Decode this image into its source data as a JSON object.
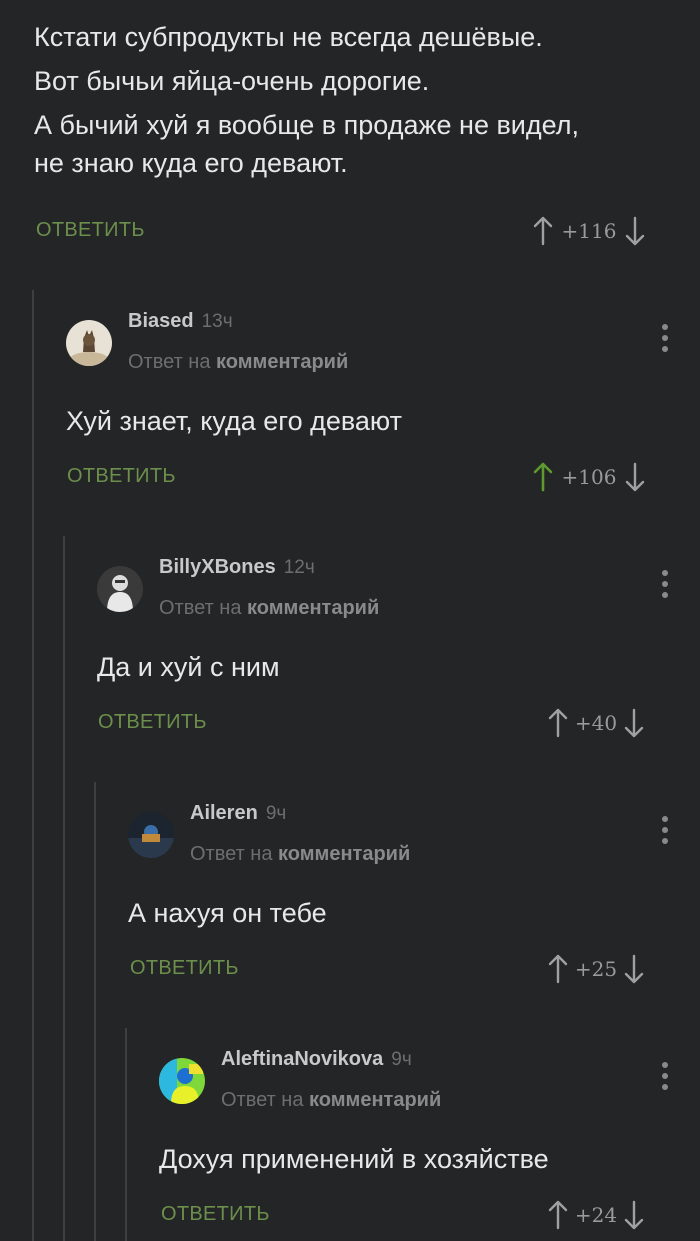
{
  "root_comment": {
    "lines": [
      "Кстати субпродукты не всегда дешёвые.",
      "Вот бычьи яйца-очень дорогие.",
      "А бычий хуй я вообще в продаже не видел,",
      "не знаю куда его девают."
    ],
    "reply_label": "ОТВЕТИТЬ",
    "score": "+116"
  },
  "comments": [
    {
      "author": "Biased",
      "time": "13ч",
      "reply_prefix": "Ответ на",
      "reply_target": "комментарий",
      "text": "Хуй знает, куда его девают",
      "reply_label": "ОТВЕТИТЬ",
      "score": "+106",
      "upvoted": true
    },
    {
      "author": "BillyXBones",
      "time": "12ч",
      "reply_prefix": "Ответ на",
      "reply_target": "комментарий",
      "text": "Да и хуй с ним",
      "reply_label": "ОТВЕТИТЬ",
      "score": "+40",
      "upvoted": false
    },
    {
      "author": "Aileren",
      "time": "9ч",
      "reply_prefix": "Ответ на",
      "reply_target": "комментарий",
      "text": "А нахуя он тебе",
      "reply_label": "ОТВЕТИТЬ",
      "score": "+25",
      "upvoted": false
    },
    {
      "author": "AleftinaNovikova",
      "time": "9ч",
      "reply_prefix": "Ответ на",
      "reply_target": "комментарий",
      "text": "Дохуя применений в хозяйстве",
      "reply_label": "ОТВЕТИТЬ",
      "score": "+24",
      "upvoted": false
    }
  ],
  "colors": {
    "background": "#232527",
    "accent_green": "#6c8f4b",
    "upvote_active": "#5e9a2e",
    "arrow_default": "#a0a0a0",
    "thread_line": "#3d3f41"
  },
  "icons": {
    "upvote": "arrow-up-icon",
    "downvote": "arrow-down-icon",
    "menu": "kebab-menu-icon"
  }
}
